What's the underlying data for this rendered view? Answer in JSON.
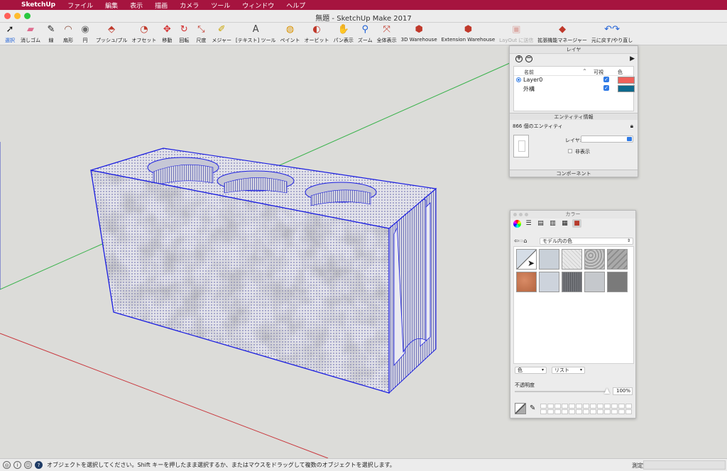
{
  "menu": {
    "apple_icon": "apple-logo-icon",
    "items": [
      "SketchUp",
      "ファイル",
      "編集",
      "表示",
      "描画",
      "カメラ",
      "ツール",
      "ウィンドウ",
      "ヘルプ"
    ]
  },
  "window": {
    "title": "無題 - SketchUp Make 2017",
    "traffic_colors": [
      "#ff5f57",
      "#febc2e",
      "#28c840"
    ]
  },
  "toolbar": {
    "tools": [
      {
        "label": "選択",
        "icon": "arrow-select-icon",
        "selected": true
      },
      {
        "label": "消しゴム",
        "icon": "eraser-icon"
      },
      {
        "label": "線",
        "icon": "pencil-icon"
      },
      {
        "label": "扇形",
        "icon": "arc-icon"
      },
      {
        "label": "円",
        "icon": "circle-icon"
      },
      {
        "label": "プッシュ/プル",
        "icon": "push-pull-icon"
      },
      {
        "label": "オフセット",
        "icon": "offset-icon"
      },
      {
        "label": "移動",
        "icon": "move-icon"
      },
      {
        "label": "回転",
        "icon": "rotate-icon"
      },
      {
        "label": "尺度",
        "icon": "scale-icon"
      },
      {
        "label": "メジャー",
        "icon": "tape-measure-icon"
      },
      {
        "label": "[テキスト] ツール",
        "icon": "text-tool-icon"
      },
      {
        "label": "ペイント",
        "icon": "paint-bucket-icon"
      },
      {
        "label": "オービット",
        "icon": "orbit-icon"
      },
      {
        "label": "パン表示",
        "icon": "pan-hand-icon"
      },
      {
        "label": "ズーム",
        "icon": "zoom-icon"
      },
      {
        "label": "全体表示",
        "icon": "zoom-extents-icon"
      },
      {
        "label": "3D Warehouse",
        "icon": "3d-warehouse-icon"
      },
      {
        "label": "Extension Warehouse",
        "icon": "extension-warehouse-icon"
      },
      {
        "label": "LayOut に送信",
        "icon": "layout-send-icon",
        "disabled": true
      },
      {
        "label": "拡張機能マネージャー",
        "icon": "extension-manager-icon"
      },
      {
        "label": "元に戻す/やり直し",
        "icon": "undo-redo-icon"
      }
    ]
  },
  "layers_panel": {
    "header": "レイヤ",
    "columns": {
      "name": "名前",
      "visible": "可視",
      "color": "色"
    },
    "rows": [
      {
        "name": "Layer0",
        "active": true,
        "visible": true,
        "color": "#f0615a"
      },
      {
        "name": "外構",
        "active": false,
        "visible": true,
        "color": "#0f6a8d"
      }
    ],
    "entity_header": "エンティティ情報",
    "entity_count": "866 個のエンティティ",
    "layer_label": "レイヤ:",
    "hidden_label": "非表示",
    "component_header": "コンポーネント"
  },
  "colors_panel": {
    "title": "カラー",
    "library": "モデル内の色",
    "material_colors": [
      "#c9d0d8",
      "#e7e7e7",
      "#bdbdbd",
      "#9a9a9a",
      "#c67954",
      "#cdd3dc",
      "#6c6e73",
      "#c5c8cc",
      "#7a7a7a"
    ],
    "dropdown_left": "色",
    "dropdown_right": "リスト",
    "opacity_label": "不透明度",
    "opacity_value": "100%"
  },
  "status": {
    "text": "オブジェクトを選択してください。Shift キーを押したまま選択するか、またはマウスをドラッグして複数のオブジェクトを選択します。",
    "measure_label": "測定"
  }
}
